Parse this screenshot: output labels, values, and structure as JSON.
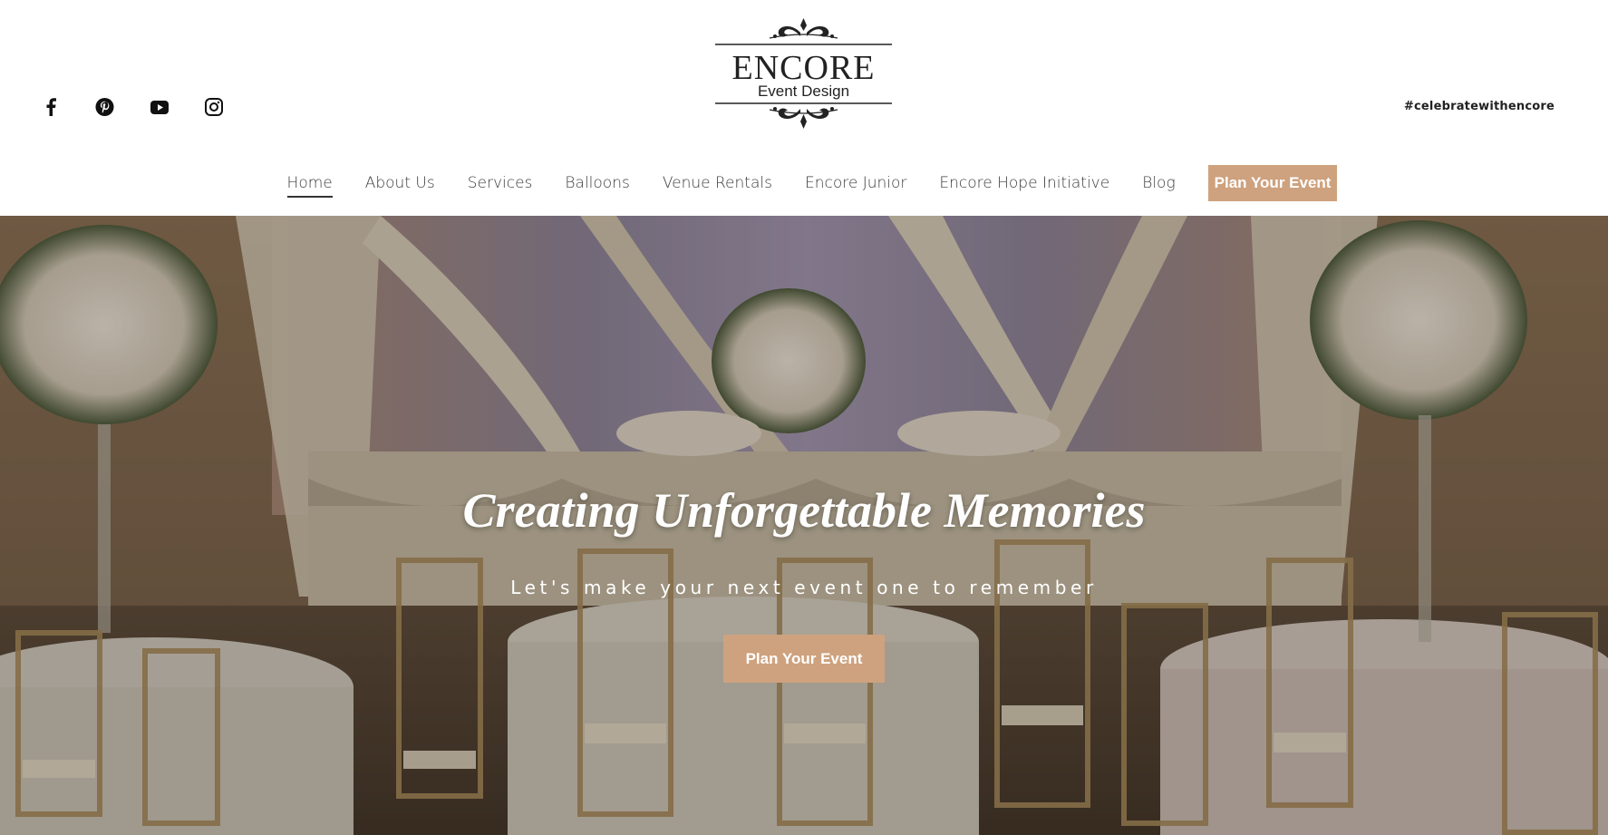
{
  "brand": {
    "name": "ENCORE",
    "tagline": "Event Design",
    "hashtag": "#celebratewithencore"
  },
  "social": [
    {
      "icon": "facebook-icon"
    },
    {
      "icon": "pinterest-icon"
    },
    {
      "icon": "youtube-icon"
    },
    {
      "icon": "instagram-icon"
    }
  ],
  "nav": {
    "items": [
      {
        "label": "Home",
        "active": true
      },
      {
        "label": "About Us"
      },
      {
        "label": "Services"
      },
      {
        "label": "Balloons"
      },
      {
        "label": "Venue Rentals"
      },
      {
        "label": "Encore Junior"
      },
      {
        "label": "Encore Hope Initiative"
      },
      {
        "label": "Blog"
      }
    ],
    "cta_label": "Plan Your Event"
  },
  "hero": {
    "title": "Creating Unforgettable Memories",
    "subtitle": "Let's make your next event one to remember",
    "cta_label": "Plan Your Event"
  },
  "colors": {
    "accent": "#cea27e",
    "text": "#3a3a3a",
    "white": "#ffffff"
  }
}
